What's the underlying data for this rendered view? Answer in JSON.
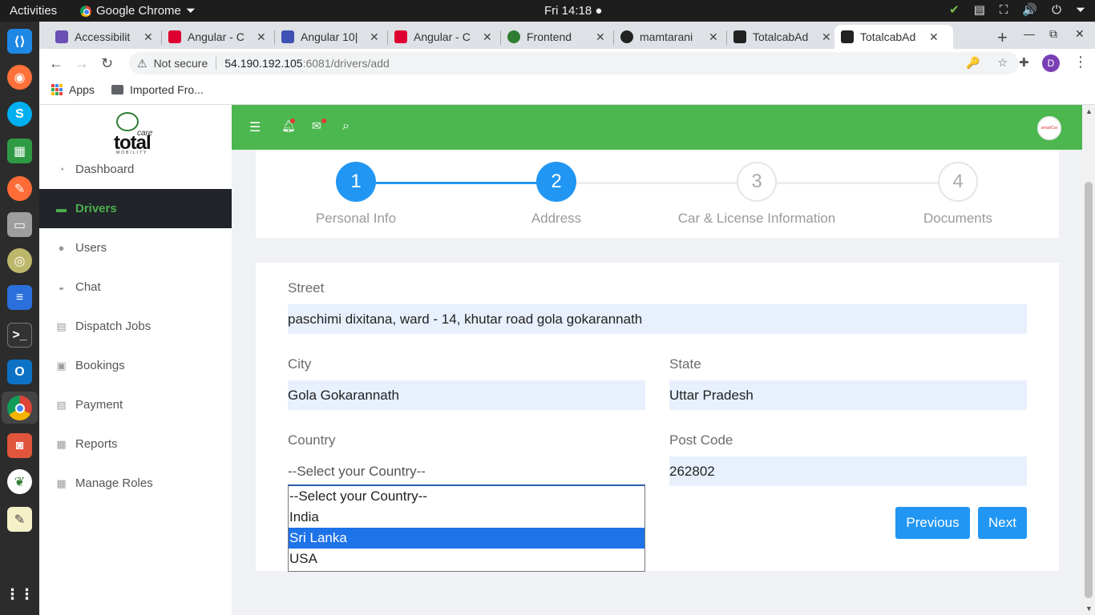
{
  "os": {
    "activities": "Activities",
    "app_name": "Google Chrome",
    "clock": "Fri 14:18"
  },
  "browser": {
    "tabs": [
      {
        "title": "Accessibilit",
        "icon": "grid-icon",
        "color": "#6a4fb5"
      },
      {
        "title": "Angular - C",
        "icon": "angular-icon",
        "color": "#dd0031"
      },
      {
        "title": "Angular 10|",
        "icon": "angular-icon",
        "color": "#3f51b5"
      },
      {
        "title": "Angular - C",
        "icon": "angular-icon",
        "color": "#dd0031"
      },
      {
        "title": "Frontend",
        "icon": "car-icon",
        "color": "#2e7d32"
      },
      {
        "title": "mamtarani",
        "icon": "github-icon",
        "color": "#222222"
      },
      {
        "title": "TotalcabAd",
        "icon": "angular-icon",
        "color": "#222222"
      },
      {
        "title": "TotalcabAd",
        "icon": "angular-icon",
        "color": "#222222"
      }
    ],
    "active_tab_index": 7,
    "address": {
      "security": "Not secure",
      "host": "54.190.192.105",
      "rest": ":6081/drivers/add"
    },
    "bookmarks": {
      "apps": "Apps",
      "folder": "Imported Fro..."
    },
    "profile_initial": "D"
  },
  "sidebar": {
    "logo": {
      "care": "care",
      "total": "total",
      "mobility": "MOBILITY"
    },
    "items": [
      {
        "label": "Dashboard",
        "icon": "dashboard-icon",
        "glyph": "◔"
      },
      {
        "label": "Drivers",
        "icon": "car-icon",
        "glyph": "🚗"
      },
      {
        "label": "Users",
        "icon": "user-icon",
        "glyph": "👤"
      },
      {
        "label": "Chat",
        "icon": "chat-icon",
        "glyph": "💬"
      },
      {
        "label": "Dispatch Jobs",
        "icon": "seat-icon",
        "glyph": "▤"
      },
      {
        "label": "Bookings",
        "icon": "briefcase-icon",
        "glyph": "▣"
      },
      {
        "label": "Payment",
        "icon": "seat-icon",
        "glyph": "▤"
      },
      {
        "label": "Reports",
        "icon": "report-icon",
        "glyph": "▦"
      },
      {
        "label": "Manage Roles",
        "icon": "report-icon",
        "glyph": "▦"
      }
    ],
    "active_index": 1
  },
  "header": {
    "avatar_text": "smartCar"
  },
  "stepper": {
    "steps": [
      {
        "number": "1",
        "label": "Personal Info",
        "state": "done"
      },
      {
        "number": "2",
        "label": "Address",
        "state": "done"
      },
      {
        "number": "3",
        "label": "Car & License Information",
        "state": "todo"
      },
      {
        "number": "4",
        "label": "Documents",
        "state": "todo"
      }
    ]
  },
  "form": {
    "street_label": "Street",
    "street_value": "paschimi dixitana, ward - 14, khutar road gola gokarannath",
    "city_label": "City",
    "city_value": "Gola Gokarannath",
    "state_label": "State",
    "state_value": "Uttar Pradesh",
    "country_label": "Country",
    "country_value": "--Select your Country--",
    "postcode_label": "Post Code",
    "postcode_value": "262802",
    "country_options": [
      "--Select your Country--",
      "India",
      "Sri Lanka",
      "USA"
    ],
    "highlighted_option_index": 2,
    "previous_label": "Previous",
    "next_label": "Next"
  },
  "colors": {
    "brand_green": "#4cb74f",
    "step_blue": "#2196f3",
    "input_bg": "#e8f0fe",
    "sidebar_active_bg": "#212529"
  }
}
